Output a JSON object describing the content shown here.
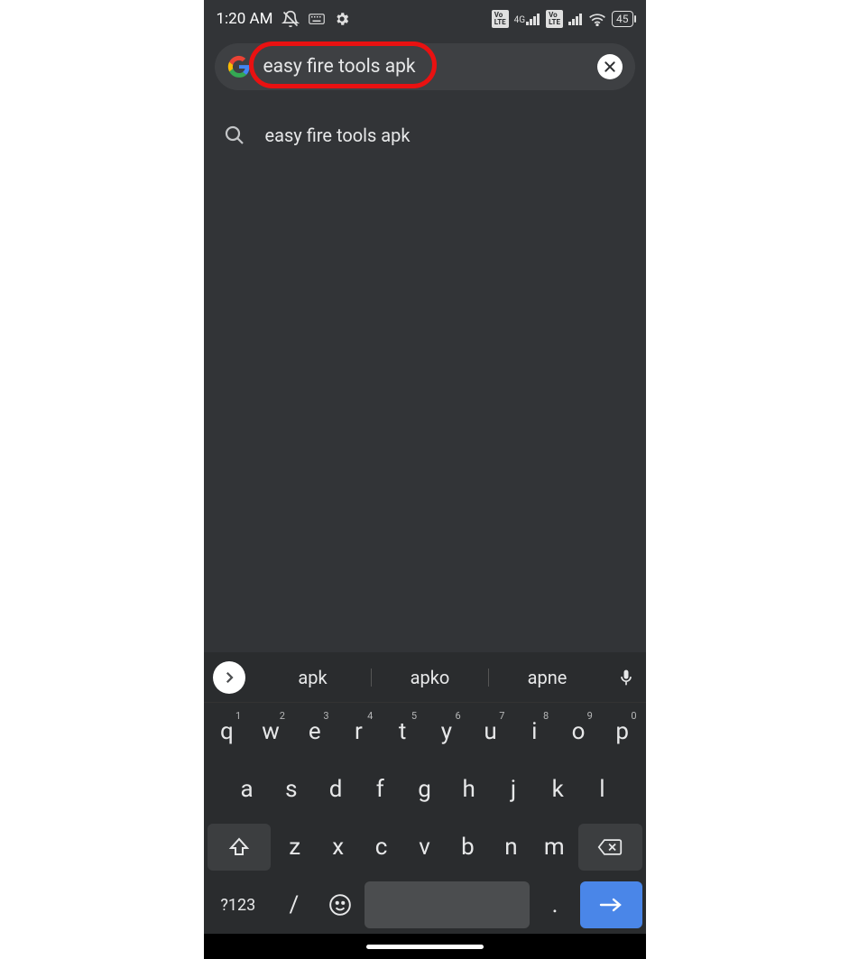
{
  "statusbar": {
    "time": "1:20 AM",
    "battery": "45"
  },
  "search": {
    "query": "easy fire tools apk"
  },
  "suggestions": [
    {
      "text": "easy fire tools apk"
    }
  ],
  "keyboard": {
    "word_suggestions": [
      "apk",
      "apko",
      "apne"
    ],
    "row1": [
      {
        "k": "q",
        "n": "1"
      },
      {
        "k": "w",
        "n": "2"
      },
      {
        "k": "e",
        "n": "3"
      },
      {
        "k": "r",
        "n": "4"
      },
      {
        "k": "t",
        "n": "5"
      },
      {
        "k": "y",
        "n": "6"
      },
      {
        "k": "u",
        "n": "7"
      },
      {
        "k": "i",
        "n": "8"
      },
      {
        "k": "o",
        "n": "9"
      },
      {
        "k": "p",
        "n": "0"
      }
    ],
    "row2": [
      "a",
      "s",
      "d",
      "f",
      "g",
      "h",
      "j",
      "k",
      "l"
    ],
    "row3": [
      "z",
      "x",
      "c",
      "v",
      "b",
      "n",
      "m"
    ],
    "sym_label": "?123",
    "slash": "/",
    "period": "."
  }
}
